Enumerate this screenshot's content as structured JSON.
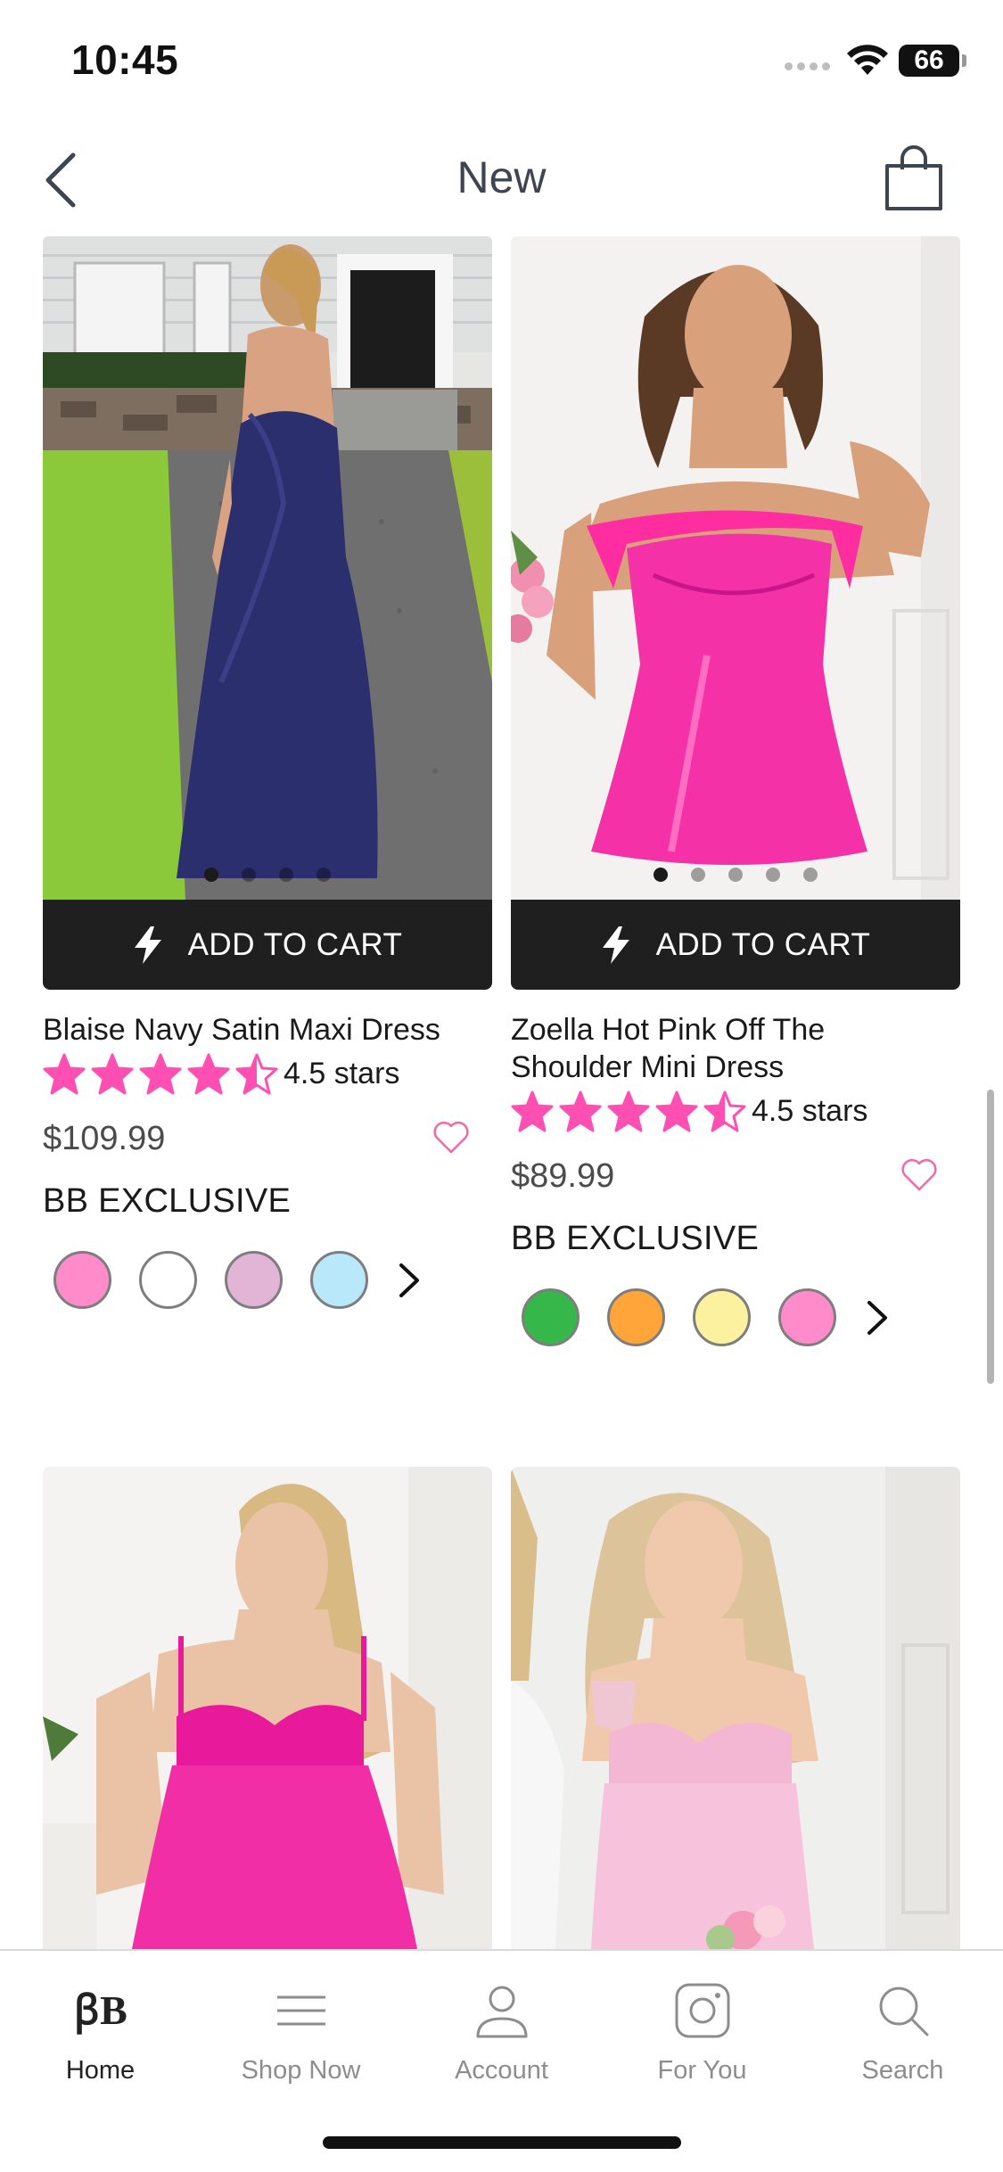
{
  "status_bar": {
    "time": "10:45",
    "battery": "66"
  },
  "nav": {
    "title": "New"
  },
  "products": [
    {
      "name": "Blaise Navy Satin Maxi Dress",
      "rating_text": "4.5 stars",
      "rating": 4.5,
      "price": "$109.99",
      "badge": "BB EXCLUSIVE",
      "add_to_cart": "ADD TO CART",
      "image_slide_count": 4,
      "active_slide": 1,
      "swatches": [
        "#ff8bcb",
        "#ffffff",
        "#e2b4d6",
        "#b9e8fb"
      ]
    },
    {
      "name": "Zoella Hot Pink Off The Shoulder Mini Dress",
      "rating_text": "4.5 stars",
      "rating": 4.5,
      "price": "$89.99",
      "badge": "BB EXCLUSIVE",
      "add_to_cart": "ADD TO CART",
      "image_slide_count": 5,
      "active_slide": 1,
      "swatches": [
        "#35b74a",
        "#ffa53a",
        "#fbf19e",
        "#ff8bcb"
      ]
    }
  ],
  "tabs": [
    {
      "label": "Home",
      "icon": "brand-logo-icon",
      "active": true
    },
    {
      "label": "Shop Now",
      "icon": "menu-icon",
      "active": false
    },
    {
      "label": "Account",
      "icon": "person-icon",
      "active": false
    },
    {
      "label": "For You",
      "icon": "instagram-icon",
      "active": false
    },
    {
      "label": "Search",
      "icon": "search-icon",
      "active": false
    }
  ],
  "colors": {
    "star_pink": "#ff4fb3",
    "heart_pink": "#f06aa6",
    "cart_bar": "#1f1f1f"
  }
}
